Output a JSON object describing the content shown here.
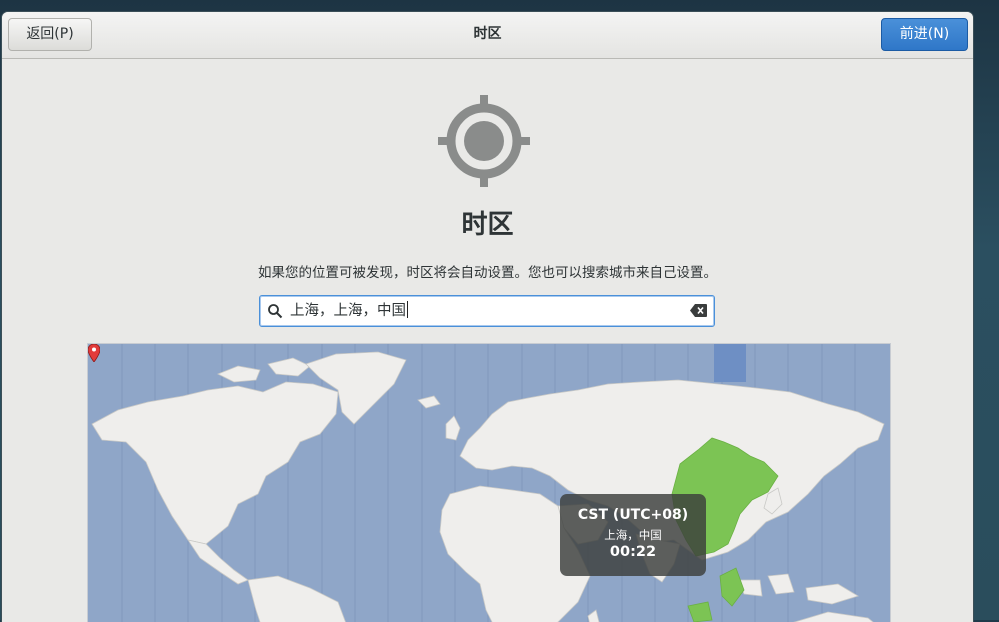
{
  "header": {
    "back_label": "返回(P)",
    "title": "时区",
    "next_label": "前进(N)"
  },
  "page": {
    "icon": "location-crosshair-icon",
    "title": "时区",
    "subtitle": "如果您的位置可被发现，时区将会自动设置。您也可以搜索城市来自己设置。"
  },
  "search": {
    "value": "上海，上海，中国",
    "icon": "search-icon",
    "clear_icon": "backspace-clear-icon"
  },
  "map": {
    "tooltip": {
      "zone": "CST (UTC+08)",
      "city": "上海，中国",
      "time": "00:22"
    },
    "pin_icon": "map-pin-icon",
    "colors": {
      "ocean": "#8fa6c8",
      "land": "#efeeec",
      "selected_zone": "#7cc454",
      "accent": "#4a90d9"
    }
  }
}
